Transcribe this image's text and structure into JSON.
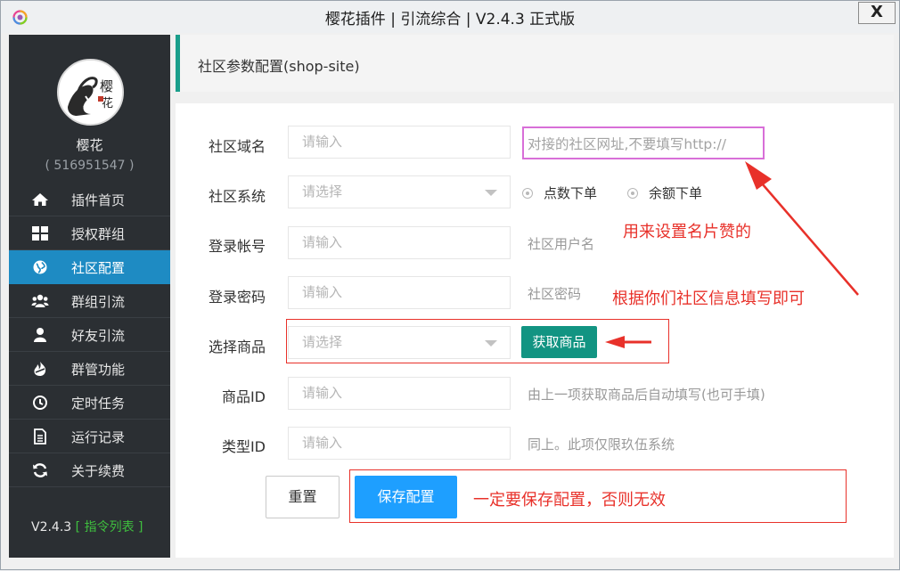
{
  "window": {
    "title": "樱花插件 | 引流综合 | V2.4.3 正式版",
    "close_label": "X"
  },
  "sidebar": {
    "user_name": "樱花",
    "user_id": "( 516951547 )",
    "items": [
      {
        "label": "插件首页",
        "icon": "home-icon"
      },
      {
        "label": "授权群组",
        "icon": "grid-icon"
      },
      {
        "label": "社区配置",
        "icon": "globe-icon",
        "active": true
      },
      {
        "label": "群组引流",
        "icon": "users-icon"
      },
      {
        "label": "好友引流",
        "icon": "user-icon"
      },
      {
        "label": "群管功能",
        "icon": "fire-icon"
      },
      {
        "label": "定时任务",
        "icon": "clock-icon"
      },
      {
        "label": "运行记录",
        "icon": "document-icon"
      },
      {
        "label": "关于续费",
        "icon": "refresh-icon"
      }
    ],
    "version": "V2.4.3",
    "command_list": "[ 指令列表 ]"
  },
  "panel": {
    "title": "社区参数配置(shop-site)"
  },
  "form": {
    "domain_label": "社区域名",
    "domain_placeholder": "请输入",
    "domain_hint": "对接的社区网址,不要填写http://",
    "system_label": "社区系统",
    "system_placeholder": "请选择",
    "radio_points": "点数下单",
    "radio_balance": "余额下单",
    "account_label": "登录帐号",
    "account_placeholder": "请输入",
    "account_hint": "社区用户名",
    "password_label": "登录密码",
    "password_placeholder": "请输入",
    "password_hint": "社区密码",
    "product_label": "选择商品",
    "product_placeholder": "请选择",
    "fetch_button": "获取商品",
    "product_id_label": "商品ID",
    "product_id_placeholder": "请输入",
    "product_id_hint": "由上一项获取商品后自动填写(也可手填)",
    "type_id_label": "类型ID",
    "type_id_placeholder": "请输入",
    "type_id_hint": "同上。此项仅限玖伍系统",
    "reset_button": "重置",
    "save_button": "保存配置"
  },
  "annotations": {
    "card_like": "用来设置名片赞的",
    "fill_info": "根据你们社区信息填写即可",
    "must_save": "一定要保存配置，否则无效"
  },
  "colors": {
    "sidebar_bg": "#2b2f33",
    "active_nav": "#1e8bc3",
    "accent_green": "#129482",
    "save_blue": "#1e9fff",
    "annotation_red": "#e8312a",
    "hint_box_purple": "#d86fd8"
  }
}
